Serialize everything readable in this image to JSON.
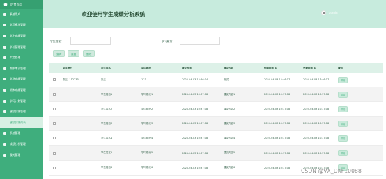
{
  "sidebar": {
    "header": "后台首页",
    "items": [
      {
        "label": "系统用户",
        "active": false,
        "icon": "person-icon"
      },
      {
        "label": "学习模块管理",
        "active": false,
        "icon": "book-icon"
      },
      {
        "label": "学生成绩管理",
        "active": false,
        "icon": "chart-icon"
      },
      {
        "label": "学院管理管理",
        "active": false,
        "icon": "folder-icon"
      },
      {
        "label": "实验管理",
        "active": false,
        "icon": "flask-icon"
      },
      {
        "label": "期中考试管理",
        "active": false,
        "icon": "clipboard-icon"
      },
      {
        "label": "学业成绩管理",
        "active": false,
        "icon": "graph-icon"
      },
      {
        "label": "期末成绩管理",
        "active": false,
        "icon": "bar-icon"
      },
      {
        "label": "学习计划管理",
        "active": false,
        "icon": "calendar-icon"
      },
      {
        "label": "建议反馈管理",
        "active": false,
        "icon": "message-icon"
      },
      {
        "label": "建议反馈列表",
        "active": true,
        "icon": "list-icon"
      },
      {
        "label": "系统管理",
        "active": false,
        "icon": "gear-icon"
      },
      {
        "label": "成绩分析管理",
        "active": false,
        "icon": "analysis-icon"
      },
      {
        "label": "我的管理",
        "active": false,
        "icon": "user-icon"
      }
    ]
  },
  "header": {
    "title": "欢迎使用学生成绩分析系统",
    "username": "admin"
  },
  "filters": {
    "student_name": {
      "label": "学生姓名：",
      "value": "",
      "placeholder": ""
    },
    "study_module": {
      "label": "学习模块：",
      "value": "",
      "placeholder": ""
    }
  },
  "actions": {
    "search": "查询",
    "reset": "重置",
    "delete": "删除"
  },
  "table": {
    "columns": [
      "学生账户",
      "学生姓名",
      "学习模块",
      "建议时间",
      "建议内容",
      "创建时间 ⇅",
      "更新时间 ⇅",
      "操作"
    ],
    "rows": [
      [
        "张三 -112233",
        "张三",
        "123",
        "2024-04-03 15:46:14",
        "测试",
        "2024-04-03 15:46:17",
        "2024-04-03 15:46:17",
        "详情"
      ],
      [
        "",
        "学生姓名1",
        "学习模块1",
        "2024-04-03 10:37:18",
        "建议内容1",
        "2024-04-03 10:37:18",
        "2024-04-03 10:37:18",
        "详情"
      ],
      [
        "",
        "学生姓名2",
        "学习模块2",
        "2024-04-03 10:37:18",
        "建议内容2",
        "2024-04-03 10:37:18",
        "2024-04-03 10:37:18",
        "详情"
      ],
      [
        "",
        "学生姓名3",
        "学习模块3",
        "2024-04-03 10:37:18",
        "建议内容3",
        "2024-04-03 10:37:18",
        "2024-04-03 10:37:18",
        "详情"
      ],
      [
        "",
        "学生姓名4",
        "学习模块4",
        "2024-04-03 10:37:18",
        "建议内容4",
        "2024-04-03 10:37:18",
        "2024-04-03 10:37:18",
        "详情"
      ],
      [
        "",
        "学生姓名5",
        "学习模块5",
        "2024-04-03 10:37:18",
        "建议内容5",
        "2024-04-03 10:37:18",
        "2024-04-03 10:37:18",
        "详情"
      ],
      [
        "",
        "学生姓名6",
        "学习模块6",
        "2024-04-03 10:37:18",
        "建议内容6",
        "2024-04-03 10:37:18",
        "2024-04-03 10:37:18",
        "详情"
      ]
    ]
  },
  "watermark": "CSDN @VX_DKF10088",
  "colors": {
    "sidebar": "#3fae7d",
    "header": "#c7ebdd",
    "accent": "#3fae7d"
  }
}
